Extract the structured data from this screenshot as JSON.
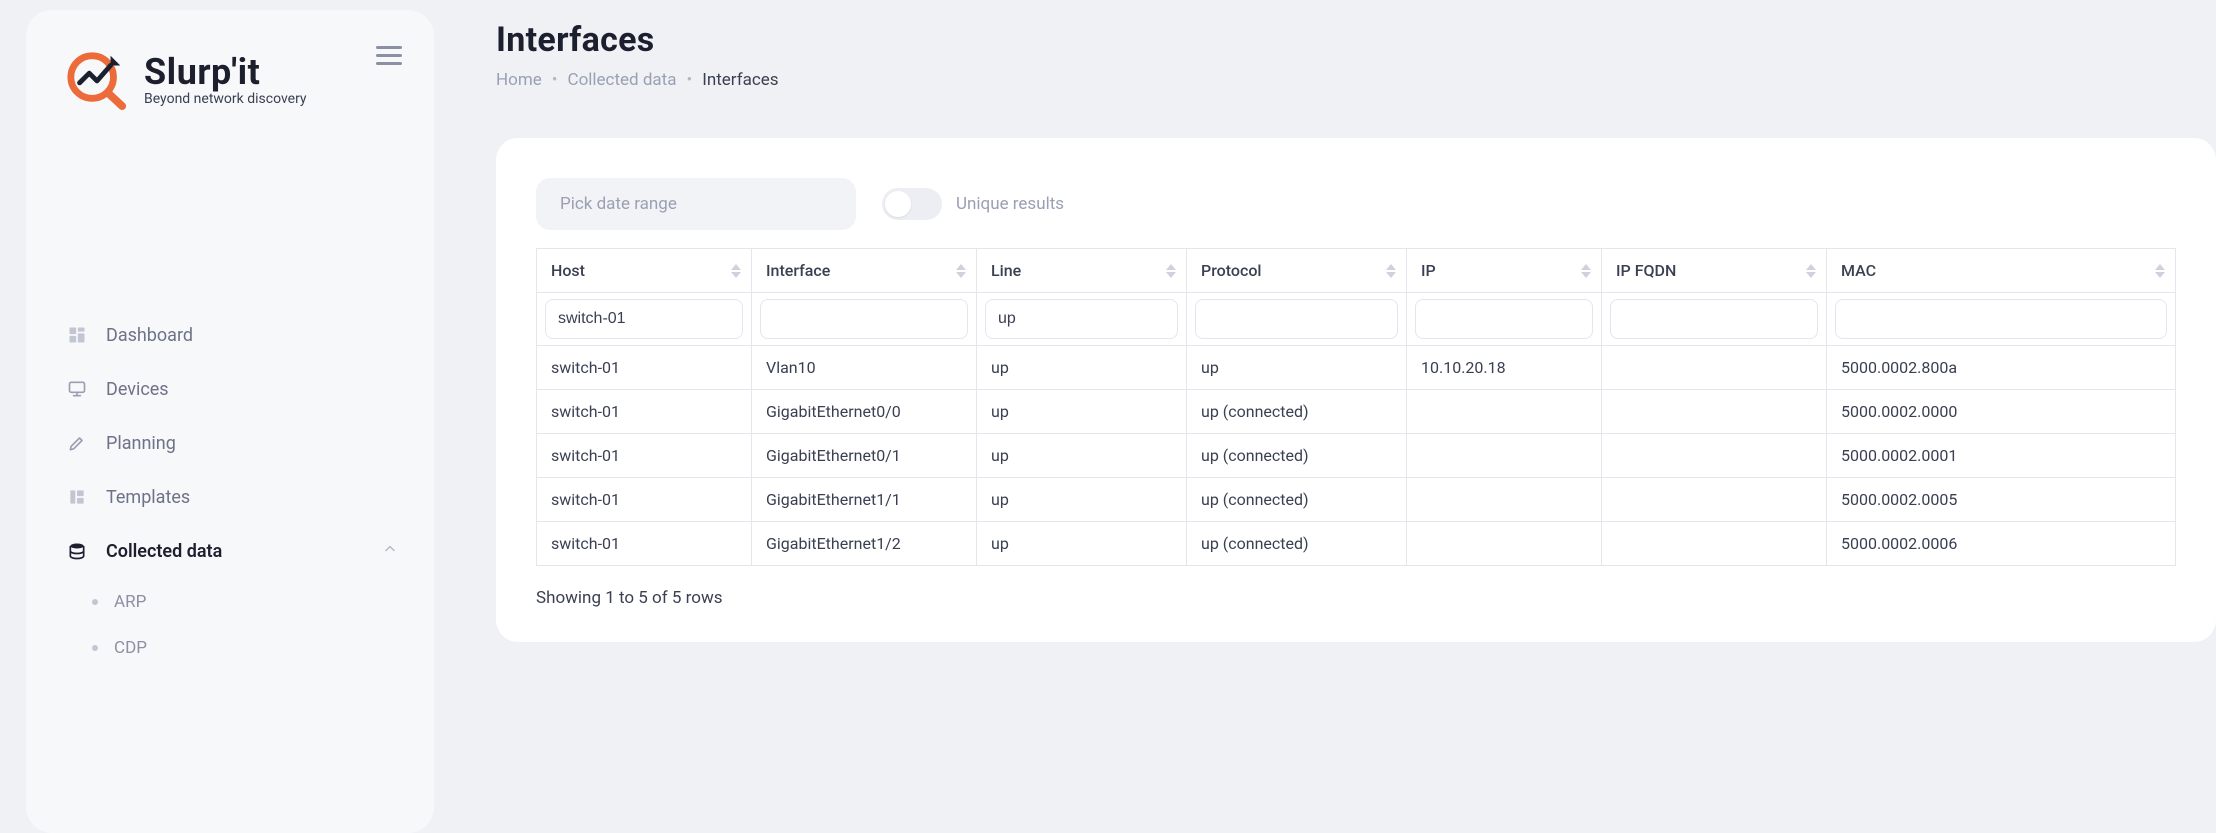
{
  "brand": {
    "name": "Slurp'it",
    "tagline": "Beyond network discovery"
  },
  "nav": {
    "items": [
      {
        "label": "Dashboard"
      },
      {
        "label": "Devices"
      },
      {
        "label": "Planning"
      },
      {
        "label": "Templates"
      },
      {
        "label": "Collected data"
      }
    ],
    "subitems": [
      {
        "label": "ARP"
      },
      {
        "label": "CDP"
      }
    ]
  },
  "page": {
    "title": "Interfaces"
  },
  "breadcrumbs": {
    "home": "Home",
    "collected": "Collected data",
    "current": "Interfaces"
  },
  "toolbar": {
    "date_placeholder": "Pick date range",
    "unique_label": "Unique results"
  },
  "table": {
    "headers": {
      "host": "Host",
      "iface": "Interface",
      "line": "Line",
      "proto": "Protocol",
      "ip": "IP",
      "fqdn": "IP FQDN",
      "mac": "MAC"
    },
    "filters": {
      "host": "switch-01",
      "line": "up"
    },
    "rows": [
      {
        "host": "switch-01",
        "iface": "Vlan10",
        "line": "up",
        "proto": "up",
        "ip": "10.10.20.18",
        "fqdn": "",
        "mac": "5000.0002.800a"
      },
      {
        "host": "switch-01",
        "iface": "GigabitEthernet0/0",
        "line": "up",
        "proto": "up (connected)",
        "ip": "",
        "fqdn": "",
        "mac": "5000.0002.0000"
      },
      {
        "host": "switch-01",
        "iface": "GigabitEthernet0/1",
        "line": "up",
        "proto": "up (connected)",
        "ip": "",
        "fqdn": "",
        "mac": "5000.0002.0001"
      },
      {
        "host": "switch-01",
        "iface": "GigabitEthernet1/1",
        "line": "up",
        "proto": "up (connected)",
        "ip": "",
        "fqdn": "",
        "mac": "5000.0002.0005"
      },
      {
        "host": "switch-01",
        "iface": "GigabitEthernet1/2",
        "line": "up",
        "proto": "up (connected)",
        "ip": "",
        "fqdn": "",
        "mac": "5000.0002.0006"
      }
    ],
    "footer": "Showing 1 to 5 of 5 rows"
  }
}
